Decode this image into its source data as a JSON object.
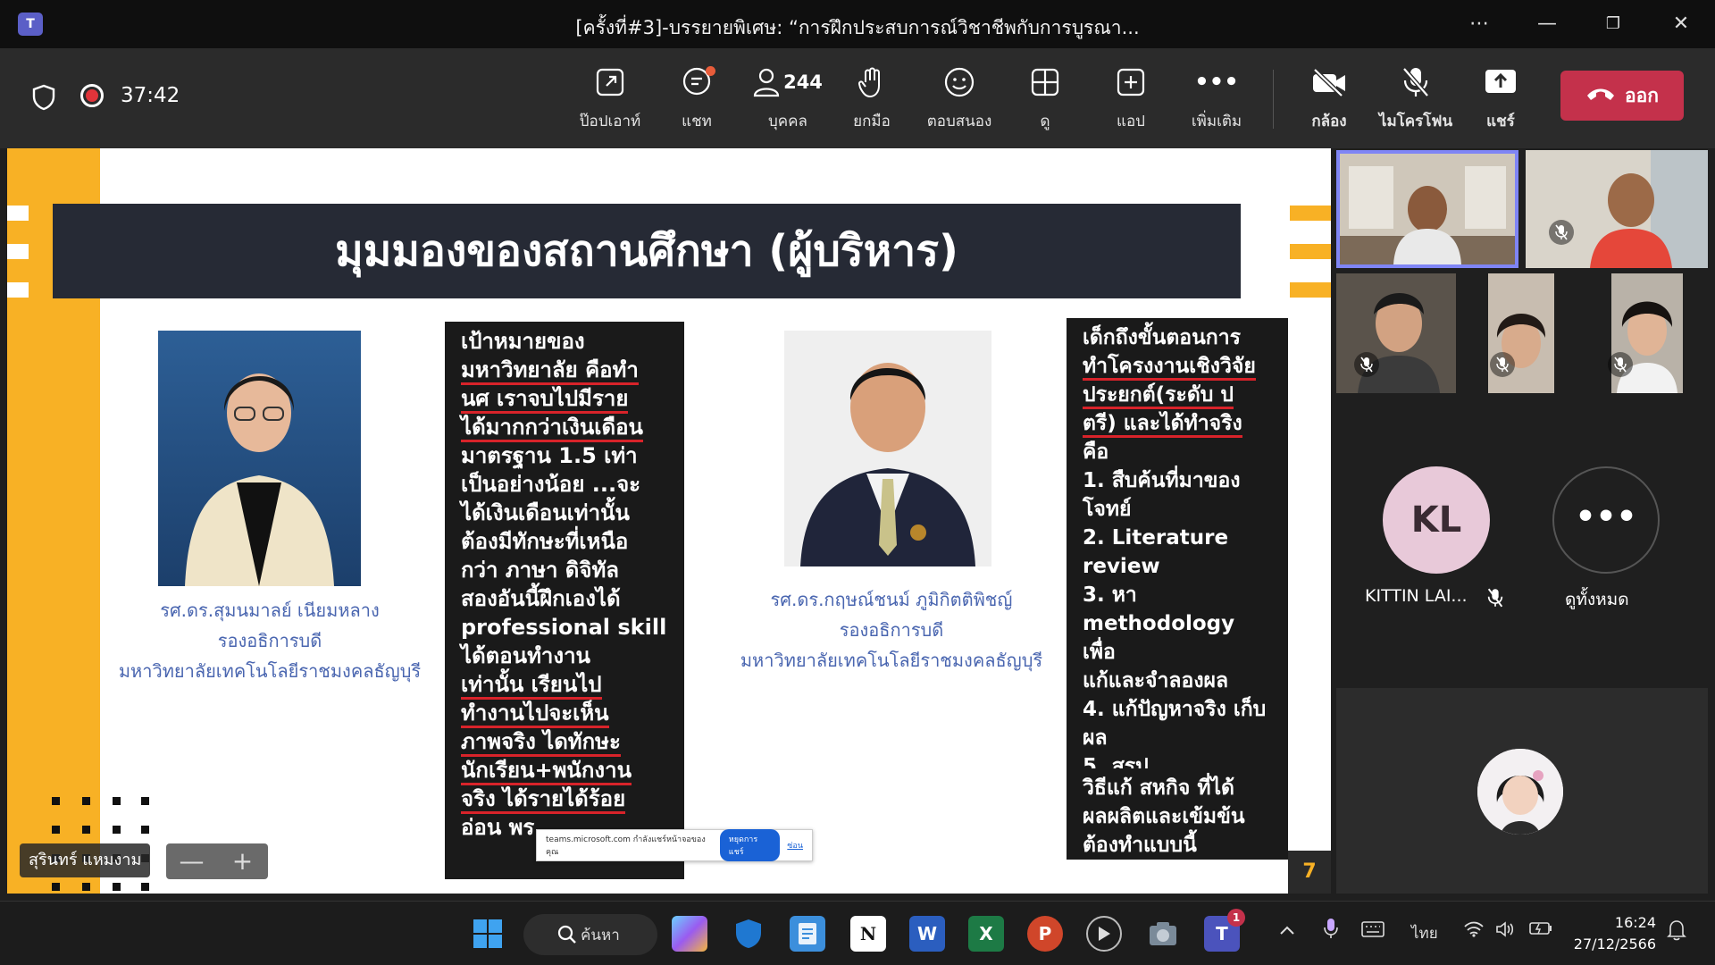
{
  "window": {
    "title": "[ครั้งที่#3]-บรรยายพิเศษ: “การฝึกประสบการณ์วิชาชีพกับการบูรณา...",
    "app_badge": "T"
  },
  "meeting": {
    "timer": "37:42",
    "tools": {
      "popout": "ป๊อปเอาท์",
      "chat": "แชท",
      "people": "บุคคล",
      "people_count": "244",
      "raise_hand": "ยกมือ",
      "react": "ตอบสนอง",
      "view": "ดู",
      "apps": "แอป",
      "more": "เพิ่มเติม",
      "camera": "กล้อง",
      "mic": "ไมโครโฟน",
      "share": "แชร์"
    },
    "leave_label": "ออก",
    "leave_color": "#c4314b"
  },
  "slide": {
    "title": "มุมมองของสถานศึกษา (ผู้บริหาร)",
    "person1": {
      "name": "รศ.ดร.สุมนมาลย์ เนียมหลาง",
      "role": "รองอธิการบดี",
      "org": "มหาวิทยาลัยเทคโนโลยีราชมงคลธัญบุรี"
    },
    "person2": {
      "name": "รศ.ดร.กฤษณ์ชนม์  ภูมิกิตติพิชญ์",
      "role": "รองอธิการบดี",
      "org": "มหาวิทยาลัยเทคโนโลยีราชมงคลธัญบุรี"
    },
    "quote1": [
      "เป้าหมายของ",
      "มหาวิทยาลัย คือทำ",
      "นศ เราจบไปมีราย",
      "ได้มากกว่าเงินเดือน",
      "มาตรฐาน 1.5 เท่า",
      "เป็นอย่างน้อย  ...จะ",
      "ได้เงินเดือนเท่านั้น",
      "ต้องมีทักษะที่เหนือ",
      "กว่า ภาษา ดิจิทัล",
      "สองอันนี้ฝึกเองได้",
      "professional skill",
      "ได้ตอนทำงาน",
      "เท่านั้น เรียนไป",
      "ทำงานไปจะเห็น",
      "ภาพจริง ไดทักษะ",
      "นักเรียน+พนักงาน",
      "จริง  ได้รายได้ร้อย",
      "อ่อน พร"
    ],
    "quote2": [
      "เด็กถึงขั้นตอนการ",
      "ทำโครงงานเชิงวิจัย",
      "ประยกต์(ระดับ ป",
      "ตรี) และได้ทำจริง",
      "คือ",
      "1. สืบค้นที่มาของ",
      "โจทย์",
      "2. Literature",
      "review",
      "3. หา",
      "methodology เพื่อ",
      "แก้และจำลองผล",
      "4. แก้ปัญหาจริง เก็บ",
      "ผล",
      "5. สรุป"
    ],
    "quote3": [
      "วิธีแก้ สหกิจ ที่ได้",
      "ผลผลิตและเข้มข้น",
      "ต้องทำแบบนี้"
    ],
    "page_number": "7",
    "accent_color": "#f8b125"
  },
  "banner": {
    "text": "teams.microsoft.com กำลังแชร์หน้าจอของคุณ",
    "stop_label": "หยุดการแชร์",
    "hide_label": "ซ่อน"
  },
  "presenter": {
    "name": "สุรินทร์ แหมงาม",
    "zoom_out": "—",
    "zoom_in": "+"
  },
  "participants": {
    "kl_initials": "KL",
    "kl_name": "KITTIN LAI...",
    "view_all_label": "ดูทั้งหมด",
    "view_all_glyph": "•••"
  },
  "taskbar": {
    "search_label": "ค้นหา",
    "teams_badge": "1",
    "language": "ไทย",
    "time": "16:24",
    "date": "27/12/2566"
  }
}
